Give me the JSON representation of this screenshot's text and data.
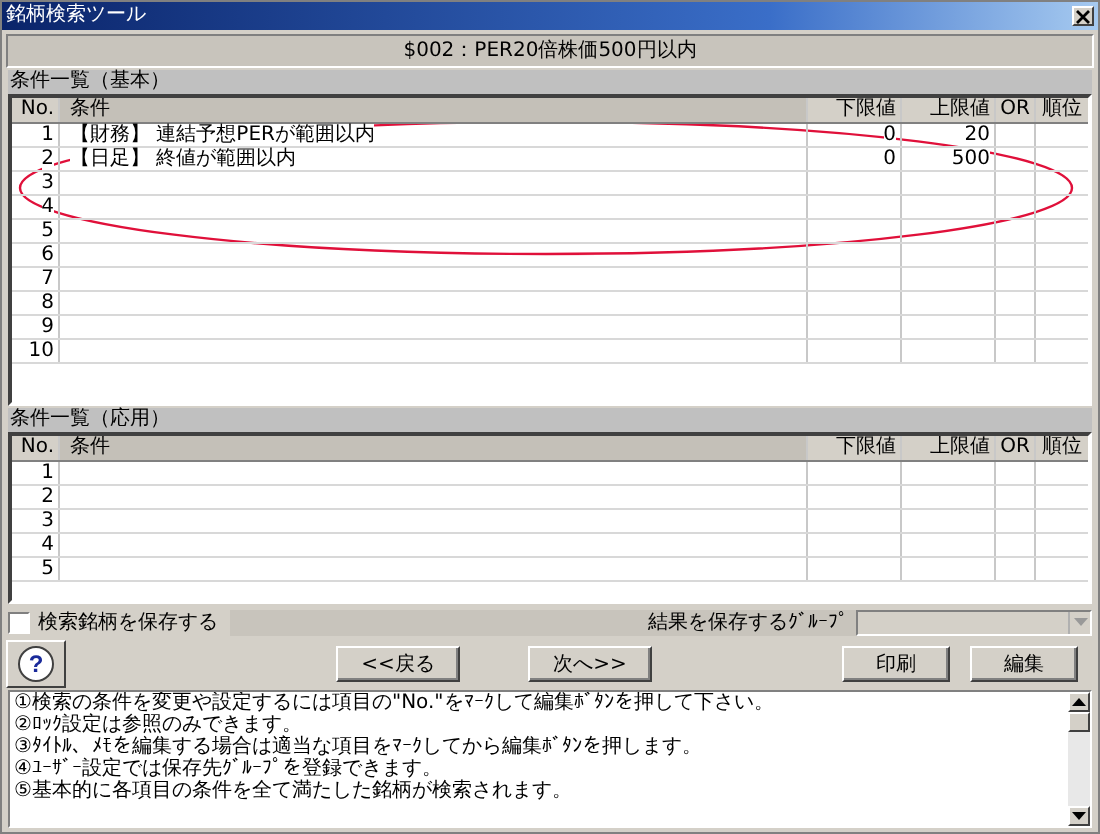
{
  "window": {
    "title": "銘柄検索ツール"
  },
  "header": "$002：PER20倍株価500円以内",
  "basic": {
    "title": "条件一覧（基本）",
    "columns": [
      "No.",
      "条件",
      "下限値",
      "上限値",
      "OR",
      "順位"
    ],
    "rows": [
      {
        "no": "1",
        "condition": "【財務】 連結予想PERが範囲以内",
        "lower": "0",
        "upper": "20"
      },
      {
        "no": "2",
        "condition": "【日足】 終値が範囲以内",
        "lower": "0",
        "upper": "500"
      },
      {
        "no": "3"
      },
      {
        "no": "4"
      },
      {
        "no": "5"
      },
      {
        "no": "6"
      },
      {
        "no": "7"
      },
      {
        "no": "8"
      },
      {
        "no": "9"
      },
      {
        "no": "10"
      }
    ]
  },
  "applied": {
    "title": "条件一覧（応用）",
    "columns": [
      "No.",
      "条件",
      "下限値",
      "上限値",
      "OR",
      "順位"
    ],
    "rows": [
      {
        "no": "1"
      },
      {
        "no": "2"
      },
      {
        "no": "3"
      },
      {
        "no": "4"
      },
      {
        "no": "5"
      }
    ]
  },
  "save_checkbox": {
    "label": "検索銘柄を保存する",
    "checked": false
  },
  "group_label": "結果を保存するｸﾞﾙｰﾌﾟ",
  "nav_buttons": [
    "<<戻る",
    "次へ>>"
  ],
  "action_buttons": [
    "印刷",
    "編集"
  ],
  "help_icon": "?",
  "help_lines": [
    "①検索の条件を変更や設定するには項目の\"No.\"をﾏｰｸして編集ﾎﾞﾀﾝを押して下さい。",
    "②ﾛｯｸ設定は参照のみできます。",
    "③ﾀｲﾄﾙ、ﾒﾓを編集する場合は適当な項目をﾏｰｸしてから編集ﾎﾞﾀﾝを押します。",
    "④ﾕｰｻﾞｰ設定では保存先ｸﾞﾙｰﾌﾟを登録できます。",
    "⑤基本的に各項目の条件を全て満たした銘柄が検索されます。"
  ]
}
